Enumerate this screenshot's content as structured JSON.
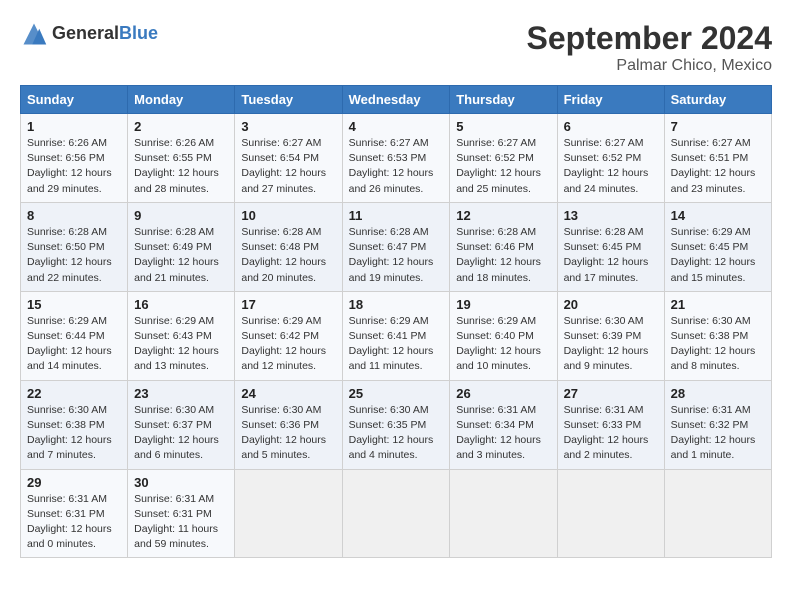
{
  "header": {
    "logo_general": "General",
    "logo_blue": "Blue",
    "month_year": "September 2024",
    "location": "Palmar Chico, Mexico"
  },
  "weekdays": [
    "Sunday",
    "Monday",
    "Tuesday",
    "Wednesday",
    "Thursday",
    "Friday",
    "Saturday"
  ],
  "weeks": [
    [
      {
        "day": "1",
        "info": "Sunrise: 6:26 AM\nSunset: 6:56 PM\nDaylight: 12 hours\nand 29 minutes."
      },
      {
        "day": "2",
        "info": "Sunrise: 6:26 AM\nSunset: 6:55 PM\nDaylight: 12 hours\nand 28 minutes."
      },
      {
        "day": "3",
        "info": "Sunrise: 6:27 AM\nSunset: 6:54 PM\nDaylight: 12 hours\nand 27 minutes."
      },
      {
        "day": "4",
        "info": "Sunrise: 6:27 AM\nSunset: 6:53 PM\nDaylight: 12 hours\nand 26 minutes."
      },
      {
        "day": "5",
        "info": "Sunrise: 6:27 AM\nSunset: 6:52 PM\nDaylight: 12 hours\nand 25 minutes."
      },
      {
        "day": "6",
        "info": "Sunrise: 6:27 AM\nSunset: 6:52 PM\nDaylight: 12 hours\nand 24 minutes."
      },
      {
        "day": "7",
        "info": "Sunrise: 6:27 AM\nSunset: 6:51 PM\nDaylight: 12 hours\nand 23 minutes."
      }
    ],
    [
      {
        "day": "8",
        "info": "Sunrise: 6:28 AM\nSunset: 6:50 PM\nDaylight: 12 hours\nand 22 minutes."
      },
      {
        "day": "9",
        "info": "Sunrise: 6:28 AM\nSunset: 6:49 PM\nDaylight: 12 hours\nand 21 minutes."
      },
      {
        "day": "10",
        "info": "Sunrise: 6:28 AM\nSunset: 6:48 PM\nDaylight: 12 hours\nand 20 minutes."
      },
      {
        "day": "11",
        "info": "Sunrise: 6:28 AM\nSunset: 6:47 PM\nDaylight: 12 hours\nand 19 minutes."
      },
      {
        "day": "12",
        "info": "Sunrise: 6:28 AM\nSunset: 6:46 PM\nDaylight: 12 hours\nand 18 minutes."
      },
      {
        "day": "13",
        "info": "Sunrise: 6:28 AM\nSunset: 6:45 PM\nDaylight: 12 hours\nand 17 minutes."
      },
      {
        "day": "14",
        "info": "Sunrise: 6:29 AM\nSunset: 6:45 PM\nDaylight: 12 hours\nand 15 minutes."
      }
    ],
    [
      {
        "day": "15",
        "info": "Sunrise: 6:29 AM\nSunset: 6:44 PM\nDaylight: 12 hours\nand 14 minutes."
      },
      {
        "day": "16",
        "info": "Sunrise: 6:29 AM\nSunset: 6:43 PM\nDaylight: 12 hours\nand 13 minutes."
      },
      {
        "day": "17",
        "info": "Sunrise: 6:29 AM\nSunset: 6:42 PM\nDaylight: 12 hours\nand 12 minutes."
      },
      {
        "day": "18",
        "info": "Sunrise: 6:29 AM\nSunset: 6:41 PM\nDaylight: 12 hours\nand 11 minutes."
      },
      {
        "day": "19",
        "info": "Sunrise: 6:29 AM\nSunset: 6:40 PM\nDaylight: 12 hours\nand 10 minutes."
      },
      {
        "day": "20",
        "info": "Sunrise: 6:30 AM\nSunset: 6:39 PM\nDaylight: 12 hours\nand 9 minutes."
      },
      {
        "day": "21",
        "info": "Sunrise: 6:30 AM\nSunset: 6:38 PM\nDaylight: 12 hours\nand 8 minutes."
      }
    ],
    [
      {
        "day": "22",
        "info": "Sunrise: 6:30 AM\nSunset: 6:38 PM\nDaylight: 12 hours\nand 7 minutes."
      },
      {
        "day": "23",
        "info": "Sunrise: 6:30 AM\nSunset: 6:37 PM\nDaylight: 12 hours\nand 6 minutes."
      },
      {
        "day": "24",
        "info": "Sunrise: 6:30 AM\nSunset: 6:36 PM\nDaylight: 12 hours\nand 5 minutes."
      },
      {
        "day": "25",
        "info": "Sunrise: 6:30 AM\nSunset: 6:35 PM\nDaylight: 12 hours\nand 4 minutes."
      },
      {
        "day": "26",
        "info": "Sunrise: 6:31 AM\nSunset: 6:34 PM\nDaylight: 12 hours\nand 3 minutes."
      },
      {
        "day": "27",
        "info": "Sunrise: 6:31 AM\nSunset: 6:33 PM\nDaylight: 12 hours\nand 2 minutes."
      },
      {
        "day": "28",
        "info": "Sunrise: 6:31 AM\nSunset: 6:32 PM\nDaylight: 12 hours\nand 1 minute."
      }
    ],
    [
      {
        "day": "29",
        "info": "Sunrise: 6:31 AM\nSunset: 6:31 PM\nDaylight: 12 hours\nand 0 minutes."
      },
      {
        "day": "30",
        "info": "Sunrise: 6:31 AM\nSunset: 6:31 PM\nDaylight: 11 hours\nand 59 minutes."
      },
      null,
      null,
      null,
      null,
      null
    ]
  ]
}
